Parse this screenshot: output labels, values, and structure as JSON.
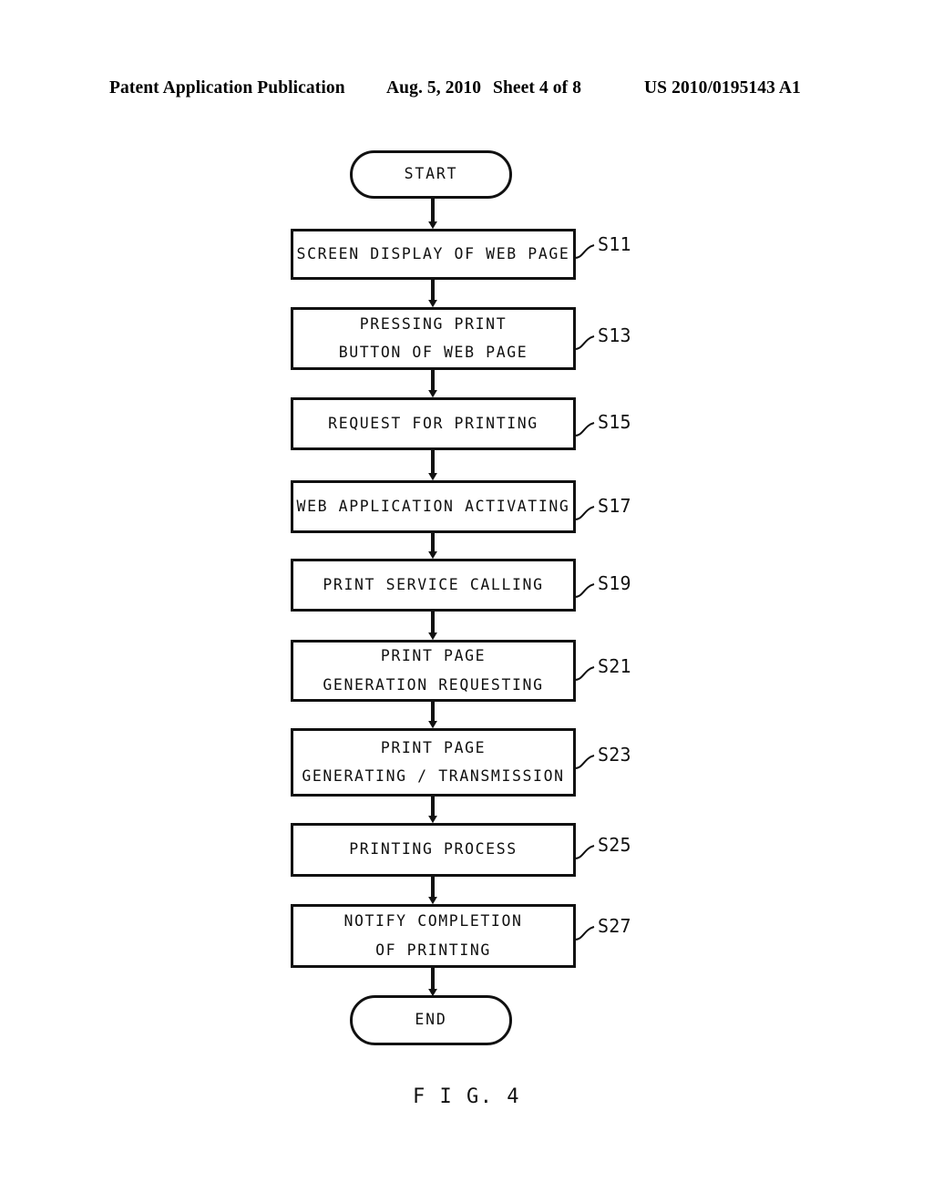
{
  "header": {
    "publication": "Patent Application Publication",
    "date": "Aug. 5, 2010",
    "sheet": "Sheet 4 of 8",
    "patent_number": "US 2010/0195143 A1"
  },
  "figure": {
    "caption": "F I G. 4",
    "type": "flowchart",
    "stroke_color": "#111111",
    "fill_color": "#ffffff"
  },
  "flowchart": {
    "start": {
      "label": "START",
      "shape": "terminal"
    },
    "end": {
      "label": "END",
      "shape": "terminal"
    },
    "steps": [
      {
        "ref": "S11",
        "shape": "process",
        "lines": [
          "SCREEN DISPLAY OF WEB PAGE"
        ]
      },
      {
        "ref": "S13",
        "shape": "process",
        "lines": [
          "PRESSING PRINT",
          "BUTTON OF WEB PAGE"
        ]
      },
      {
        "ref": "S15",
        "shape": "process",
        "lines": [
          "REQUEST FOR PRINTING"
        ]
      },
      {
        "ref": "S17",
        "shape": "process",
        "lines": [
          "WEB APPLICATION ACTIVATING"
        ]
      },
      {
        "ref": "S19",
        "shape": "process",
        "lines": [
          "PRINT SERVICE CALLING"
        ]
      },
      {
        "ref": "S21",
        "shape": "process",
        "lines": [
          "PRINT PAGE",
          "GENERATION REQUESTING"
        ]
      },
      {
        "ref": "S23",
        "shape": "process",
        "lines": [
          "PRINT PAGE",
          "GENERATING / TRANSMISSION"
        ]
      },
      {
        "ref": "S25",
        "shape": "process",
        "lines": [
          "PRINTING PROCESS"
        ]
      },
      {
        "ref": "S27",
        "shape": "process",
        "lines": [
          "NOTIFY COMPLETION",
          "OF PRINTING"
        ]
      }
    ]
  }
}
